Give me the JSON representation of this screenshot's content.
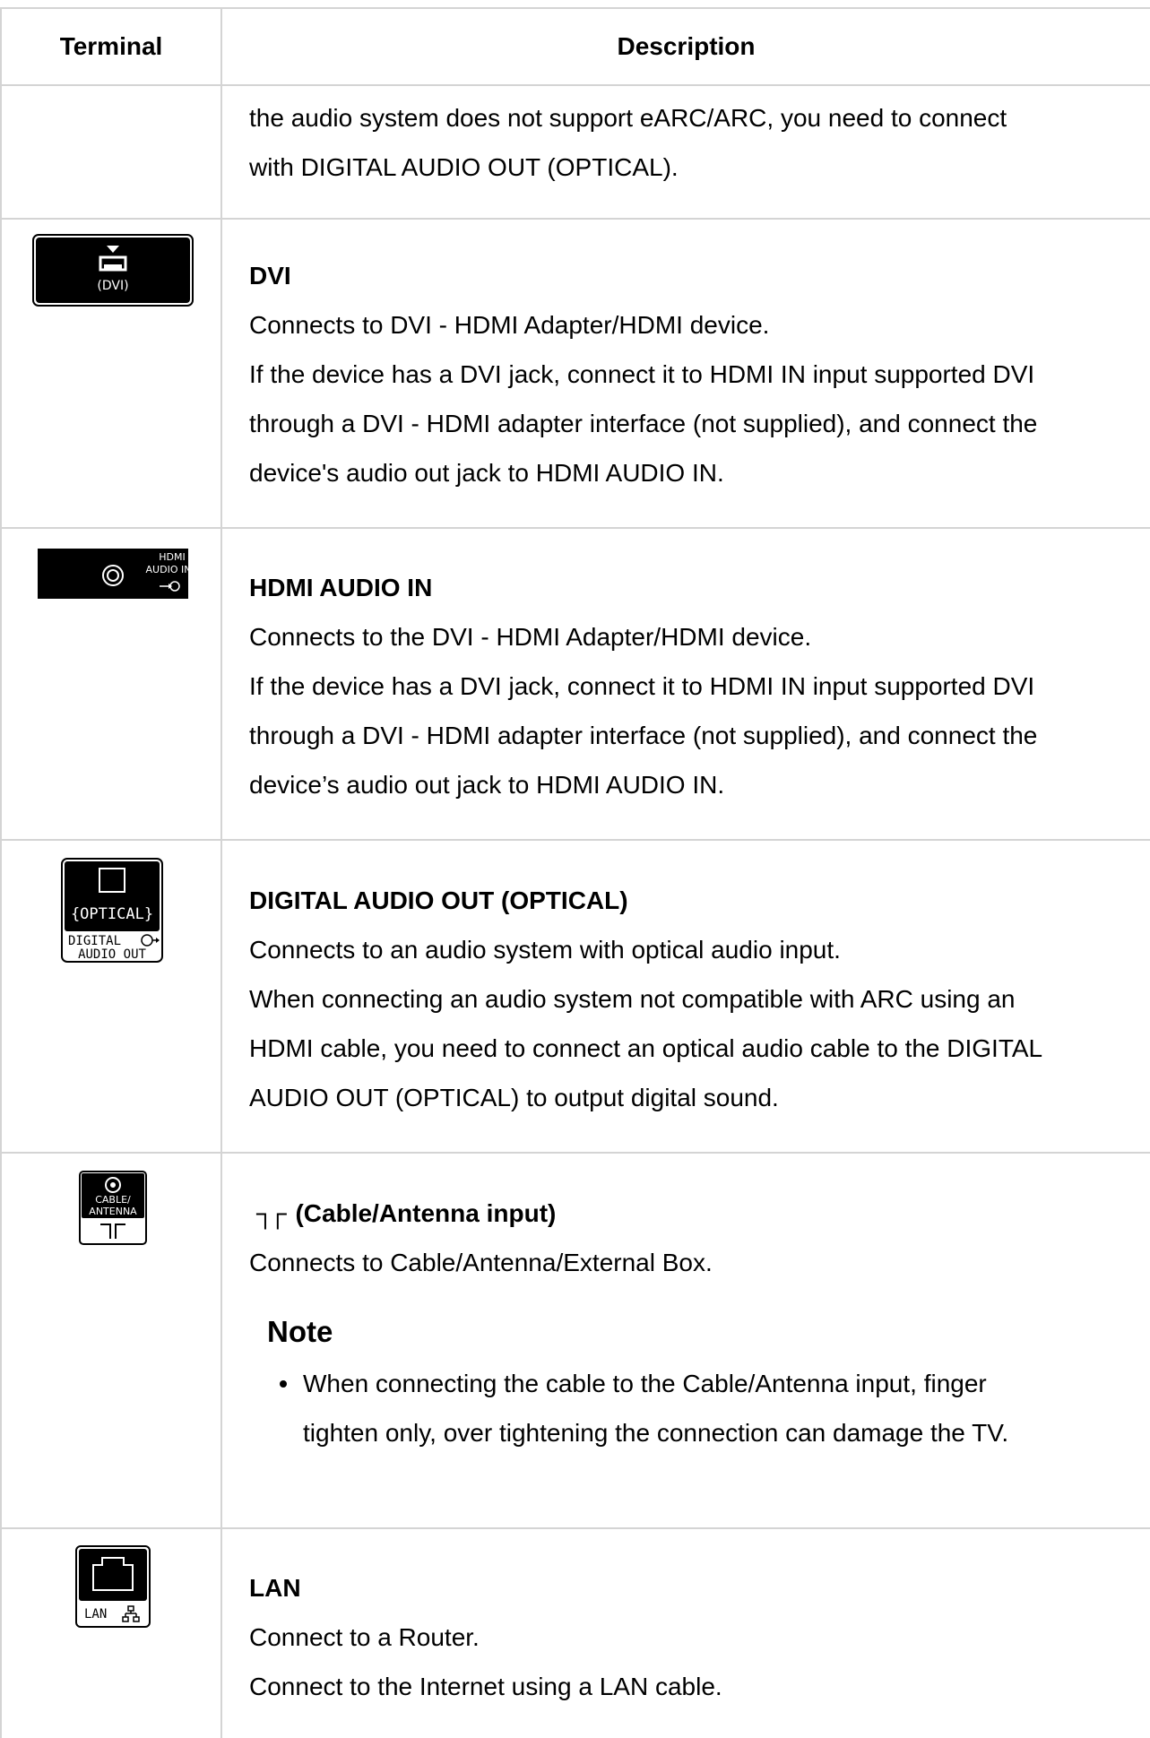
{
  "header": {
    "terminal": "Terminal",
    "description": "Description"
  },
  "rows": [
    {
      "lines": [
        "the audio system does not support eARC/ARC, you need to connect",
        "with DIGITAL AUDIO OUT (OPTICAL)."
      ]
    },
    {
      "icon_name": "hdmi-dvi-port-icon",
      "icon_label": "(DVI)",
      "title": "DVI",
      "lines": [
        "Connects to DVI - HDMI Adapter/HDMI device.",
        "If the device has a DVI jack, connect it to HDMI IN input supported DVI",
        "through a DVI - HDMI adapter interface (not supplied), and connect the",
        "device's audio out jack to HDMI AUDIO IN."
      ]
    },
    {
      "icon_name": "hdmi-audio-in-port-icon",
      "icon_label": [
        "HDMI",
        "AUDIO IN"
      ],
      "title": "HDMI AUDIO IN",
      "lines": [
        "Connects to the DVI - HDMI Adapter/HDMI device.",
        "If the device has a DVI jack, connect it to HDMI IN input supported DVI",
        "through a DVI - HDMI adapter interface (not supplied), and connect the",
        "device’s audio out jack to HDMI AUDIO IN."
      ]
    },
    {
      "icon_name": "optical-audio-out-port-icon",
      "icon_label": [
        "{OPTICAL}",
        "DIGITAL",
        "AUDIO OUT"
      ],
      "title": "DIGITAL AUDIO OUT (OPTICAL)",
      "lines": [
        "Connects to an audio system with optical audio input.",
        "When connecting an audio system not compatible with ARC using an",
        "HDMI cable, you need to connect an optical audio cable to the DIGITAL",
        "AUDIO OUT (OPTICAL) to output digital sound."
      ]
    },
    {
      "icon_name": "cable-antenna-port-icon",
      "icon_label": [
        "CABLE/",
        "ANTENNA"
      ],
      "title_symbol": "┐┌",
      "title": "(Cable/Antenna input)",
      "lines": [
        "Connects to Cable/Antenna/External Box."
      ],
      "note": {
        "title": "Note",
        "items": [
          "When connecting the cable to the Cable/Antenna input, finger tighten only, over tightening the connection can damage the TV."
        ],
        "item_lines": [
          "When connecting the cable to the Cable/Antenna input, finger",
          "tighten only, over tightening the connection can damage the TV."
        ]
      }
    },
    {
      "icon_name": "lan-port-icon",
      "icon_label": "LAN",
      "title": "LAN",
      "lines": [
        "Connect to a Router.",
        "Connect to the Internet using a LAN cable."
      ]
    }
  ]
}
